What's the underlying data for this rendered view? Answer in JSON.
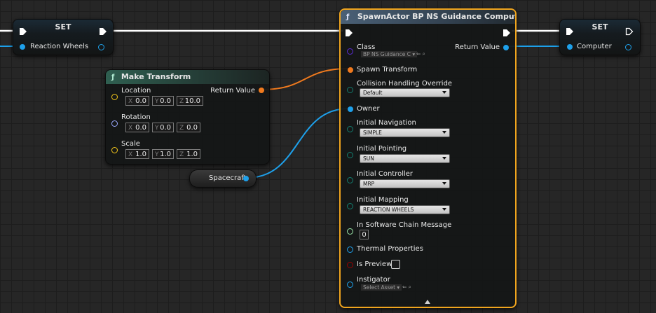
{
  "colors": {
    "exec": "#ffffff",
    "object": "#1ea0ea",
    "struct": "#f07a1e",
    "byte": "#137d6f",
    "class": "#5b2bd5",
    "vector": "#f4c71a",
    "rotator": "#9aa8ff",
    "bool": "#9a0000",
    "int": "#9ae6a8",
    "selection": "#f0a51e"
  },
  "set_left": {
    "title": "SET",
    "var_label": "Reaction Wheels"
  },
  "set_right": {
    "title": "SET",
    "var_label": "Computer"
  },
  "make_transform": {
    "title": "Make Transform",
    "output_label": "Return Value",
    "location": {
      "label": "Location",
      "x": "0.0",
      "y": "0.0",
      "z": "10.0"
    },
    "rotation": {
      "label": "Rotation",
      "x": "0.0",
      "y": "0.0",
      "z": "0.0"
    },
    "scale": {
      "label": "Scale",
      "x": "1.0",
      "y": "1.0",
      "z": "1.0"
    },
    "axis": {
      "x": "X",
      "y": "Y",
      "z": "Z"
    }
  },
  "spacecraft": {
    "label": "Spacecraft"
  },
  "spawn": {
    "title": "SpawnActor BP NS Guidance Computer",
    "return_label": "Return Value",
    "class_label": "Class",
    "class_value": "BP NS Guidance C",
    "spawn_transform": "Spawn Transform",
    "collision_label": "Collision Handling Override",
    "collision_value": "Default",
    "owner_label": "Owner",
    "nav_label": "Initial Navigation",
    "nav_value": "SIMPLE",
    "pointing_label": "Initial Pointing",
    "pointing_value": "SUN",
    "controller_label": "Initial Controller",
    "controller_value": "MRP",
    "mapping_label": "Initial Mapping",
    "mapping_value": "REACTION WHEELS",
    "software_label": "In Software Chain Message",
    "software_value": "0",
    "thermal_label": "Thermal Properties",
    "preview_label": "Is Preview",
    "instigator_label": "Instigator",
    "instigator_value": "Select Asset"
  }
}
